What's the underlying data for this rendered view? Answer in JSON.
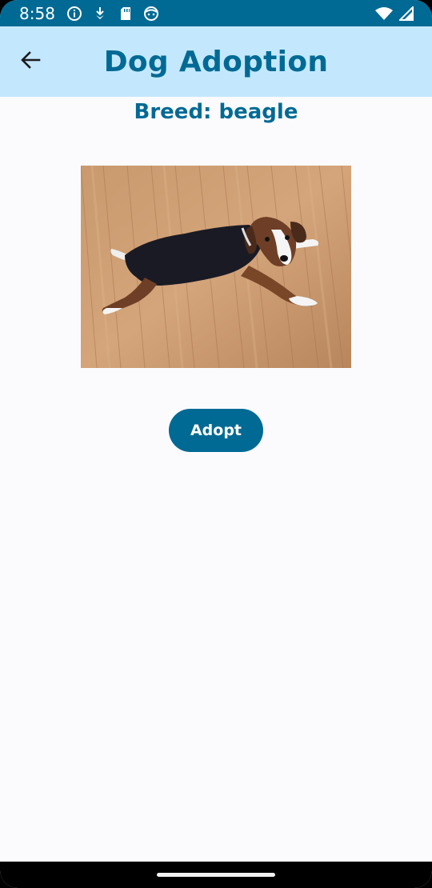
{
  "status_bar": {
    "time": "8:58",
    "left_icons": [
      "info-icon",
      "download-icon",
      "sd-card-icon",
      "face-icon"
    ],
    "right_icons": [
      "wifi-icon",
      "signal-icon"
    ]
  },
  "app_bar": {
    "title": "Dog Adoption",
    "back_icon": "arrow-back-icon"
  },
  "content": {
    "breed_text": "Breed: beagle",
    "photo_alt": "beagle lying on wooden floor",
    "adopt_label": "Adopt"
  },
  "colors": {
    "primary": "#006a94",
    "app_bar_bg": "#c3e8fd",
    "background": "#fbfbfe"
  }
}
